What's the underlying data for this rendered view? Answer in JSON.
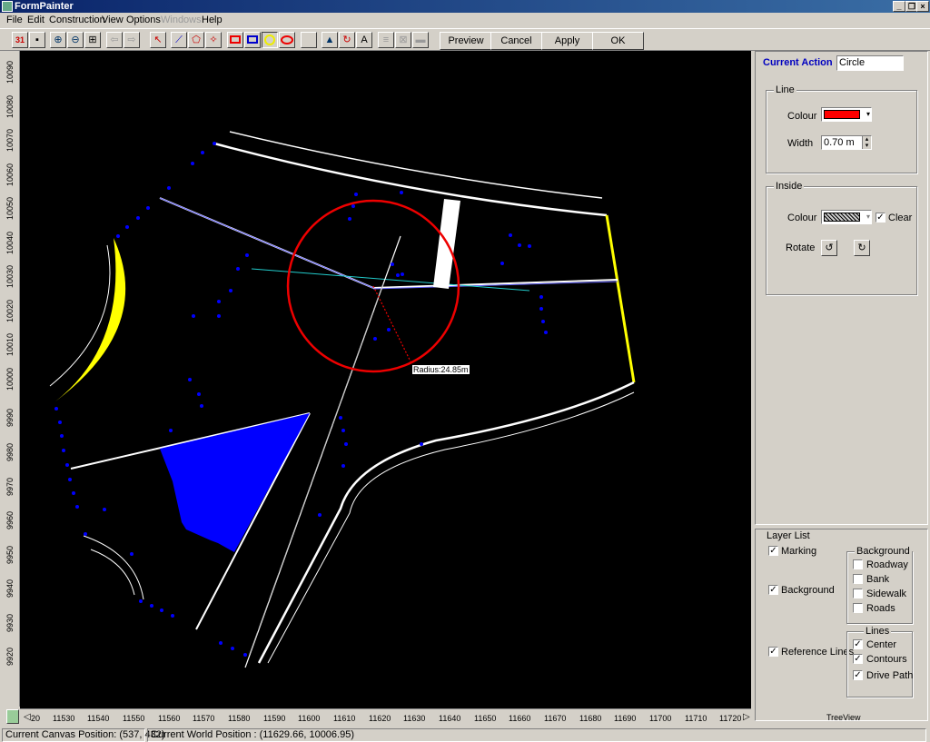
{
  "window": {
    "title": "FormPainter"
  },
  "menu": [
    "File",
    "Edit",
    "Construction",
    "View",
    "Options",
    "Windows",
    "Help"
  ],
  "toolbar": {
    "preview": "Preview",
    "cancel": "Cancel",
    "apply": "Apply",
    "ok": "OK",
    "text_tool": "A"
  },
  "rulers": {
    "x_ticks": [
      "20",
      "11530",
      "11540",
      "11550",
      "11560",
      "11570",
      "11580",
      "11590",
      "11600",
      "11610",
      "11620",
      "11630",
      "11640",
      "11650",
      "11660",
      "11670",
      "11680",
      "11690",
      "11700",
      "11710",
      "11720"
    ],
    "y_ticks": [
      "10090",
      "10080",
      "10070",
      "10060",
      "10050",
      "10040",
      "10030",
      "10020",
      "10010",
      "10000",
      "9990",
      "9980",
      "9970",
      "9960",
      "9950",
      "9940",
      "9930",
      "9920"
    ]
  },
  "canvas": {
    "radius_label": "Radius:24.85m"
  },
  "panel": {
    "current_action_label": "Current Action",
    "current_action_value": "Circle",
    "line_group": "Line",
    "colour_label": "Colour",
    "width_label": "Width",
    "width_value": "0.70 m",
    "line_colour": "#ff0000",
    "inside_group": "Inside",
    "inside_colour_label": "Colour",
    "clear_label": "Clear",
    "rotate_label": "Rotate"
  },
  "layers": {
    "title": "Layer List",
    "marking": "Marking",
    "background": "Background",
    "reference_lines": "Reference Lines",
    "background_group": "Background",
    "background_items": [
      "Roadway",
      "Bank",
      "Sidewalk",
      "Roads"
    ],
    "lines_group": "Lines",
    "lines_items": [
      "Center",
      "Contours",
      "Drive Path"
    ],
    "treeview": "TreeView"
  },
  "status": {
    "canvas_position": "Current Canvas Position: (537, 432)",
    "world_position": "Current World Position : (11629.66, 10006.95)"
  }
}
